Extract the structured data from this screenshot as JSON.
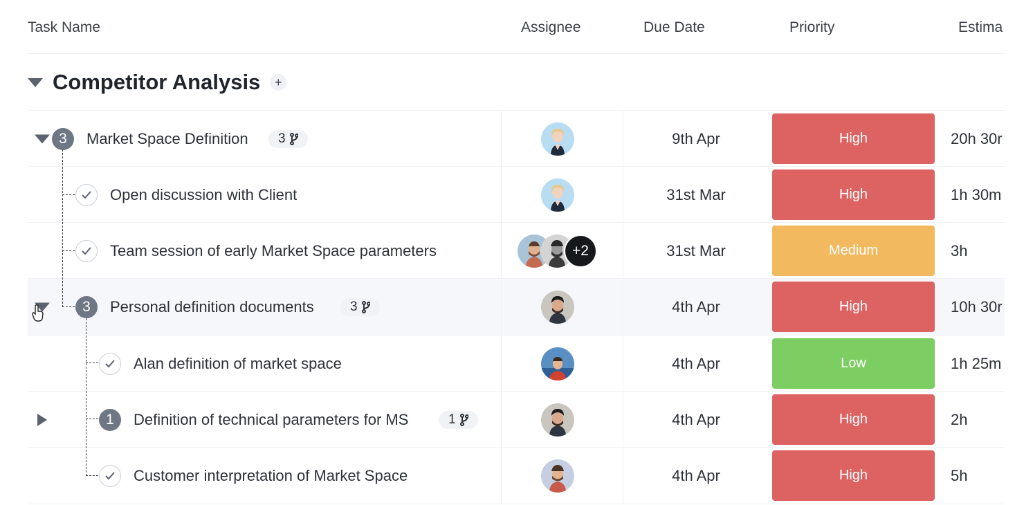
{
  "columns": {
    "task_name": "Task Name",
    "assignee": "Assignee",
    "due_date": "Due Date",
    "priority": "Priority",
    "estimate": "Estima"
  },
  "group": {
    "title": "Competitor Analysis",
    "add_label": "+"
  },
  "colors": {
    "high": "#dc6361",
    "medium": "#f2b95f",
    "low": "#7cce63",
    "badge": "#6f7684"
  },
  "rows": [
    {
      "badge": "3",
      "name": "Market Space Definition",
      "subtasks": "3",
      "due": "9th Apr",
      "priority": "High",
      "estimate": "20h 30r"
    },
    {
      "name": "Open discussion with Client",
      "due": "31st Mar",
      "priority": "High",
      "estimate": "1h 30m"
    },
    {
      "name": "Team session of early Market Space parameters",
      "more": "+2",
      "due": "31st Mar",
      "priority": "Medium",
      "estimate": "3h"
    },
    {
      "badge": "3",
      "name": "Personal definition documents",
      "subtasks": "3",
      "due": "4th Apr",
      "priority": "High",
      "estimate": "10h 30r"
    },
    {
      "name": "Alan definition of market space",
      "due": "4th Apr",
      "priority": "Low",
      "estimate": "1h 25m"
    },
    {
      "badge": "1",
      "name": "Definition of technical parameters for MS",
      "subtasks": "1",
      "due": "4th Apr",
      "priority": "High",
      "estimate": "2h"
    },
    {
      "name": "Customer interpretation of Market Space",
      "due": "4th Apr",
      "priority": "High",
      "estimate": "5h"
    }
  ]
}
